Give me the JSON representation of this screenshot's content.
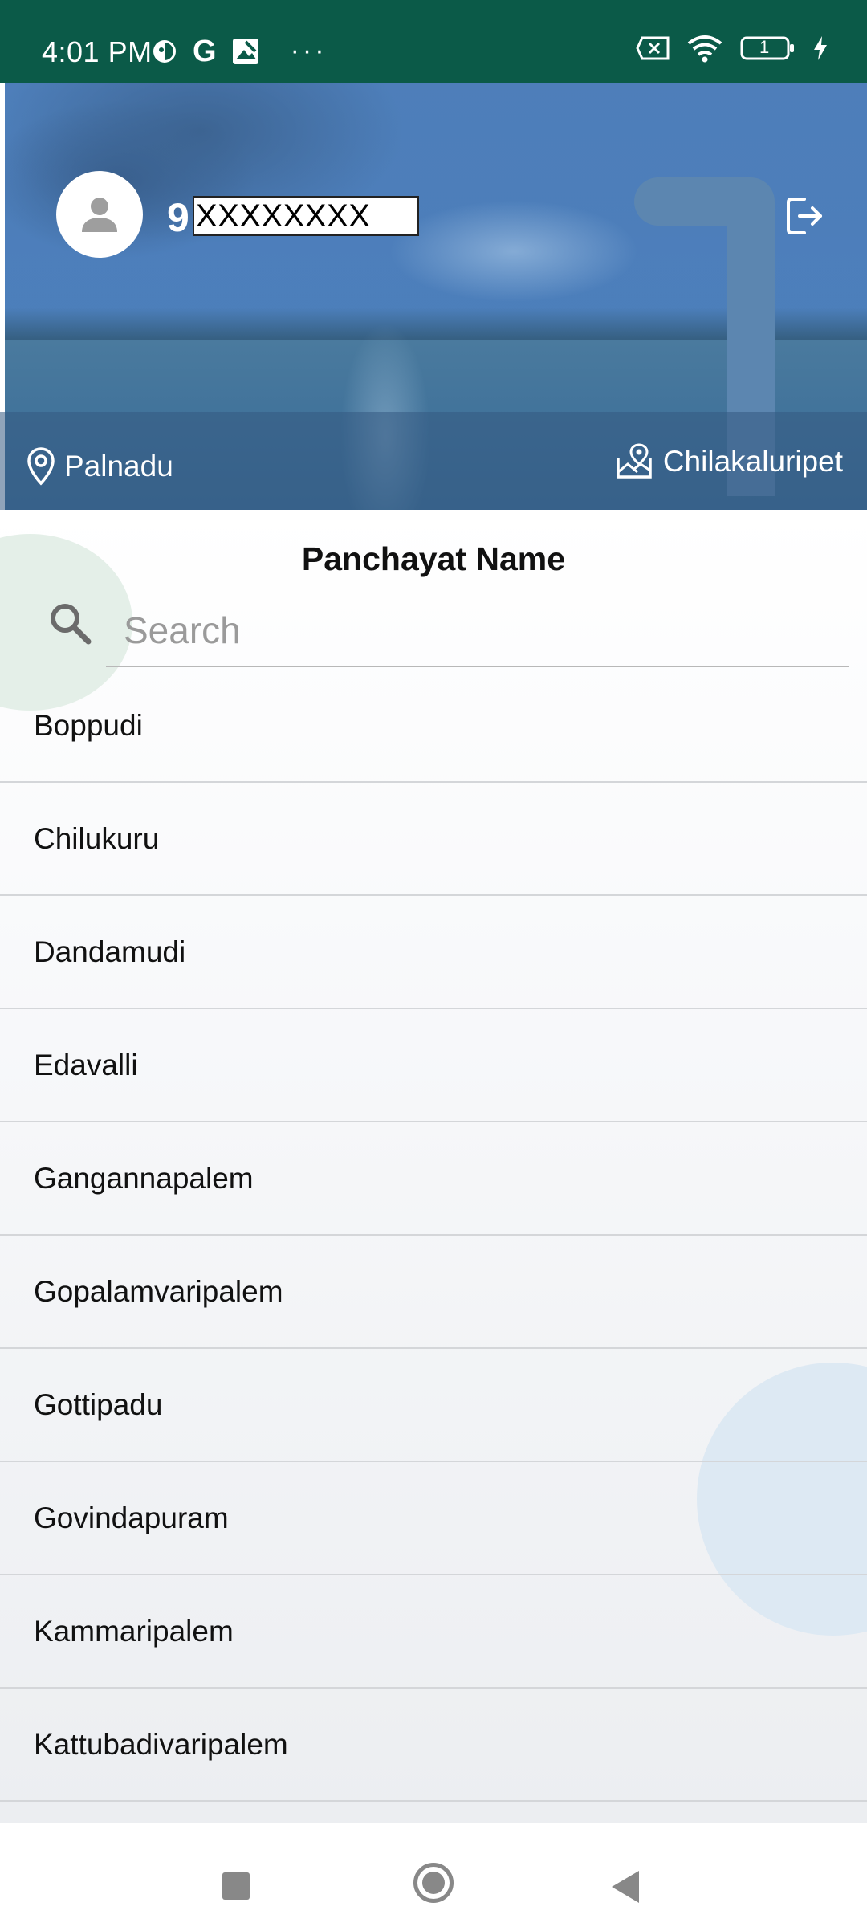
{
  "status_bar": {
    "time": "4:01 PM",
    "overflow": "···",
    "battery_level": "1",
    "background_color": "#0b5a48"
  },
  "header": {
    "phone_first_digit": "9",
    "phone_masked": "XXXXXXXX",
    "district": "Palnadu",
    "mandal": "Chilakaluripet"
  },
  "main": {
    "section_title": "Panchayat Name",
    "search": {
      "placeholder": "Search",
      "value": ""
    },
    "panchayats": [
      "Boppudi",
      "Chilukuru",
      "Dandamudi",
      "Edavalli",
      "Gangannapalem",
      "Gopalamvaripalem",
      "Gottipadu",
      "Govindapuram",
      "Kammaripalem",
      "Kattubadivaripalem"
    ]
  },
  "icons": {
    "avatar": "person-icon",
    "logout": "logout-icon",
    "district": "location-pin-icon",
    "mandal": "map-pin-icon",
    "search": "search-icon"
  }
}
